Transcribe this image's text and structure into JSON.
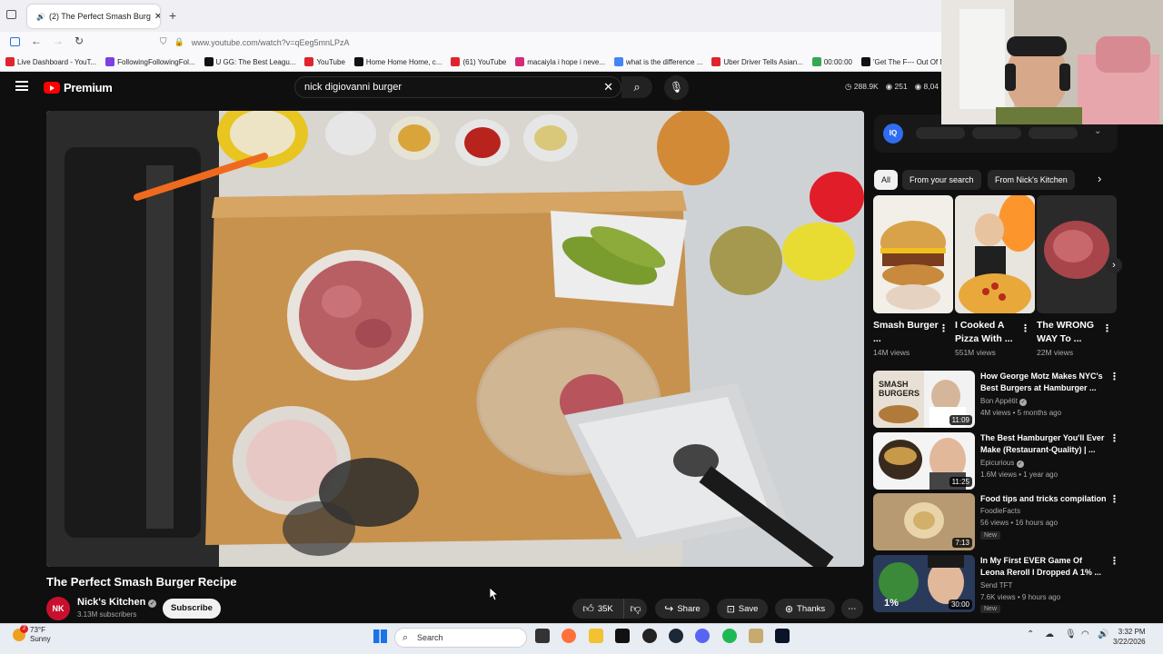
{
  "browser": {
    "tab_title": "(2) The Perfect Smash Burg",
    "url": "www.youtube.com/watch?v=qEeg5mnLPzA",
    "bookmarks": [
      {
        "label": "Live Dashboard - YouT...",
        "color": "#e0242e"
      },
      {
        "label": "FollowingFollowingFol...",
        "color": "#7b3fe4"
      },
      {
        "label": "U GG: The Best Leagu...",
        "color": "#111111"
      },
      {
        "label": "YouTube",
        "color": "#e0242e"
      },
      {
        "label": "Home Home Home, c...",
        "color": "#111111"
      },
      {
        "label": "(61) YouTube",
        "color": "#e0242e"
      },
      {
        "label": "macaiyla i hope i neve...",
        "color": "#d62976"
      },
      {
        "label": "what is the difference ...",
        "color": "#4285f4"
      },
      {
        "label": "Uber Driver Tells Asian...",
        "color": "#e0242e"
      },
      {
        "label": "00:00:00",
        "color": "#34a853"
      },
      {
        "label": "'Get The F--- Out Of M...",
        "color": "#111111"
      }
    ]
  },
  "youtube": {
    "logo_text": "Premium",
    "search_query": "nick digiovanni burger",
    "stats": [
      "288.9K",
      "251",
      "8,04"
    ]
  },
  "video": {
    "title": "The Perfect Smash Burger Recipe",
    "channel_initials": "NK",
    "channel_name": "Nick's Kitchen",
    "subscribers": "3.13M subscribers",
    "subscribe_label": "Subscribe",
    "likes": "35K",
    "share_label": "Share",
    "save_label": "Save",
    "thanks_label": "Thanks"
  },
  "sidebar": {
    "extension_badge": "IQ",
    "chips": [
      "All",
      "From your search",
      "From Nick's Kitchen"
    ],
    "shorts": [
      {
        "title": "Smash Burger ...",
        "views": "14M views"
      },
      {
        "title": "I Cooked A Pizza With ...",
        "views": "551M views"
      },
      {
        "title": "The WRONG WAY To ...",
        "views": "22M views"
      }
    ],
    "recommendations": [
      {
        "title": "How George Motz Makes NYC's Best Burgers at Hamburger ...",
        "channel": "Bon Appétit",
        "meta": "4M views • 5 months ago",
        "duration": "11:09",
        "badge": ""
      },
      {
        "title": "The Best Hamburger You'll Ever Make (Restaurant-Quality) | ...",
        "channel": "Epicurious",
        "meta": "1.6M views • 1 year ago",
        "duration": "11:25",
        "badge": ""
      },
      {
        "title": "Food tips and tricks compilation",
        "channel": "FoodieFacts",
        "meta": "56 views • 16 hours ago",
        "duration": "7:13",
        "badge": "New"
      },
      {
        "title": "In My First EVER Game Of Leona Reroll I Dropped A 1% ...",
        "channel": "Send TFT",
        "meta": "7.6K views • 9 hours ago",
        "duration": "30:00",
        "badge": "New"
      }
    ]
  },
  "taskbar": {
    "weather_temp": "73°F",
    "weather_desc": "Sunny",
    "weather_badge": "2",
    "search_label": "Search",
    "time": "3:32 PM",
    "date": "3/22/2026"
  }
}
